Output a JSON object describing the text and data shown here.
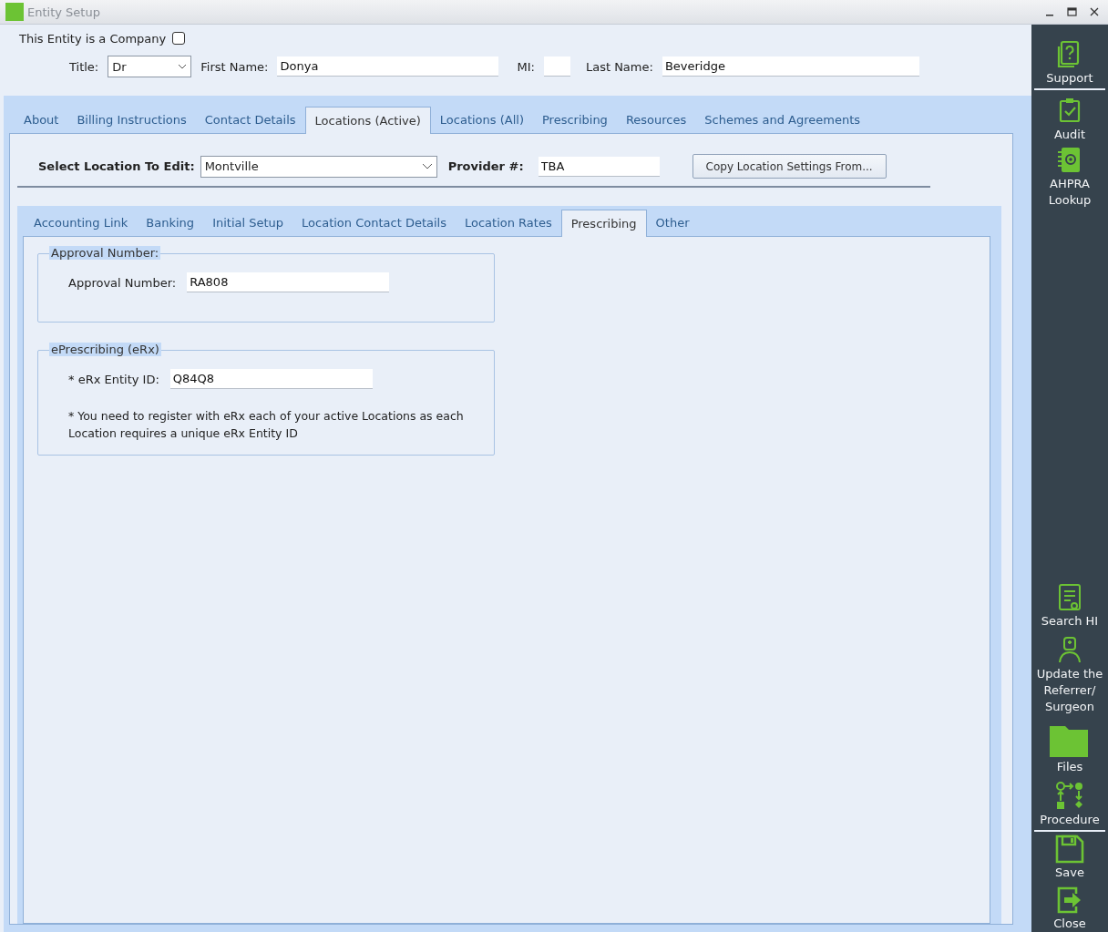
{
  "window": {
    "title": "Entity Setup"
  },
  "header": {
    "company_label": "This Entity is a Company",
    "company_checked": false,
    "title_label": "Title:",
    "title_value": "Dr",
    "first_name_label": "First Name:",
    "first_name": "Donya",
    "mi_label": "MI:",
    "last_name_label": "Last Name:",
    "last_name": "Beveridge"
  },
  "tabs": [
    {
      "label": "About",
      "selected": false
    },
    {
      "label": "Billing Instructions",
      "selected": false
    },
    {
      "label": "Contact Details",
      "selected": false
    },
    {
      "label": "Locations (Active)",
      "selected": true
    },
    {
      "label": "Locations (All)",
      "selected": false
    },
    {
      "label": "Prescribing",
      "selected": false
    },
    {
      "label": "Resources",
      "selected": false
    },
    {
      "label": "Schemes and Agreements",
      "selected": false
    }
  ],
  "location": {
    "select_label": "Select Location To Edit:",
    "select_value": "Montville",
    "provider_label": "Provider #:",
    "provider_value": "TBA",
    "copy_button": "Copy Location Settings From..."
  },
  "subtabs": [
    {
      "label": "Accounting Link",
      "selected": false
    },
    {
      "label": "Banking",
      "selected": false
    },
    {
      "label": "Initial Setup",
      "selected": false
    },
    {
      "label": "Location Contact Details",
      "selected": false
    },
    {
      "label": "Location Rates",
      "selected": false
    },
    {
      "label": "Prescribing",
      "selected": true
    },
    {
      "label": "Other",
      "selected": false
    }
  ],
  "groups": [
    {
      "legend": "Approval Number:",
      "field_label": "Approval Number:",
      "field_value": "RA808"
    },
    {
      "legend": "ePrescribing (eRx)",
      "field_label": "* eRx Entity ID:",
      "field_value": "Q84Q8",
      "note": "* You need to register with eRx each of your active Locations as each Location requires a unique eRx Entity ID"
    }
  ],
  "sidebar": {
    "sections": [
      {
        "items": [
          {
            "label": "Support"
          }
        ]
      },
      {
        "items": [
          {
            "label": "Audit"
          },
          {
            "label": "AHPRA Lookup"
          }
        ]
      },
      {
        "items": [
          {
            "label": "Search HI"
          },
          {
            "label": "Update the Referrer/ Surgeon"
          },
          {
            "label": "Files"
          },
          {
            "label": "Procedure"
          }
        ]
      },
      {
        "items": [
          {
            "label": "Save"
          },
          {
            "label": "Close"
          }
        ]
      }
    ]
  }
}
